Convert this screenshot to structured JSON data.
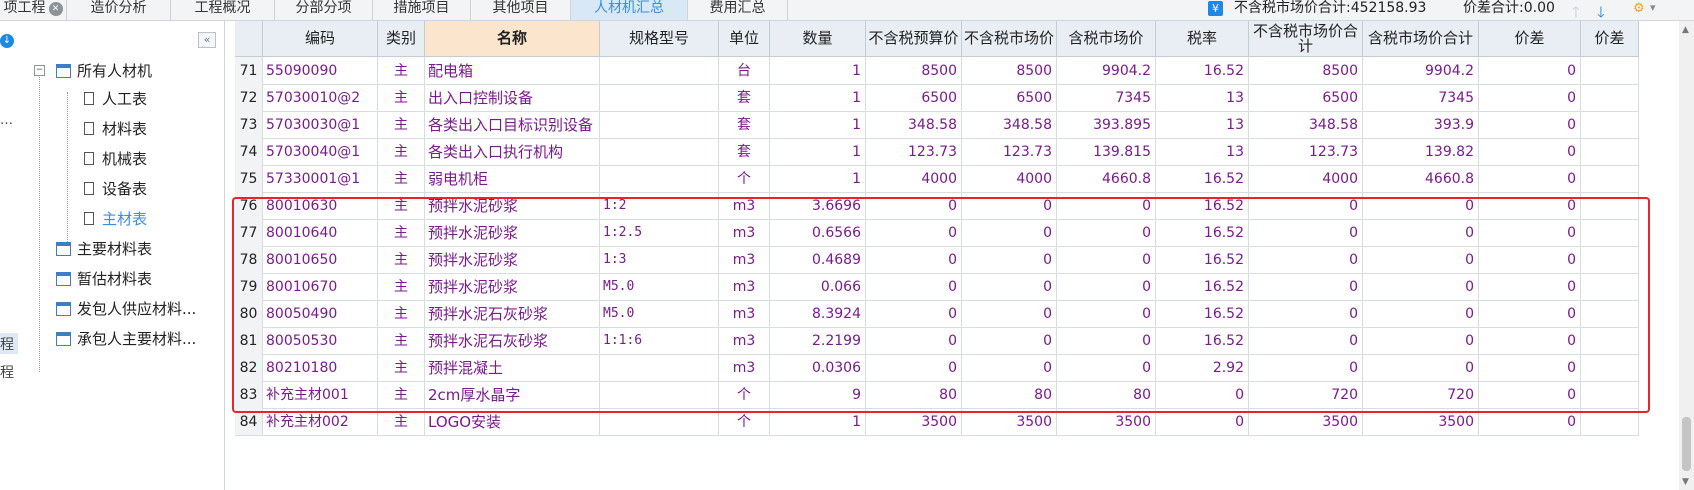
{
  "tabs": [
    {
      "label": "项工程",
      "closable": true
    },
    {
      "label": "造价分析"
    },
    {
      "label": "工程概况"
    },
    {
      "label": "分部分项"
    },
    {
      "label": "措施项目"
    },
    {
      "label": "其他项目"
    },
    {
      "label": "人材机汇总",
      "active": true
    },
    {
      "label": "费用汇总"
    }
  ],
  "summary": {
    "market_total": "不含税市场价合计:452158.93",
    "diff_total": "价差合计:0.00"
  },
  "left_strip": {
    "dots": "…",
    "item_a": "程",
    "item_b": "程"
  },
  "tree": [
    {
      "label": "所有人材机",
      "icon": "table-icon"
    },
    {
      "label": "人工表",
      "icon": "doc-icon"
    },
    {
      "label": "材料表",
      "icon": "doc-icon"
    },
    {
      "label": "机械表",
      "icon": "doc-icon"
    },
    {
      "label": "设备表",
      "icon": "doc-icon"
    },
    {
      "label": "主材表",
      "icon": "doc-icon",
      "selected": true
    },
    {
      "label": "主要材料表",
      "icon": "table-icon"
    },
    {
      "label": "暂估材料表",
      "icon": "table-icon"
    },
    {
      "label": "发包人供应材料...",
      "icon": "table-icon"
    },
    {
      "label": "承包人主要材料...",
      "icon": "table-icon"
    }
  ],
  "columns": [
    "",
    "编码",
    "类别",
    "名称",
    "规格型号",
    "单位",
    "数量",
    "不含税预算价",
    "不含税市场价",
    "含税市场价",
    "税率",
    "不含税市场价合计",
    "含税市场价合计",
    "价差",
    "价差"
  ],
  "rows": [
    [
      "71",
      "55090090",
      "主",
      "配电箱",
      "",
      "台",
      "1",
      "8500",
      "8500",
      "9904.2",
      "16.52",
      "8500",
      "9904.2",
      "0",
      ""
    ],
    [
      "72",
      "57030010@2",
      "主",
      "出入口控制设备",
      "",
      "套",
      "1",
      "6500",
      "6500",
      "7345",
      "13",
      "6500",
      "7345",
      "0",
      ""
    ],
    [
      "73",
      "57030030@1",
      "主",
      "各类出入口目标识别设备",
      "",
      "套",
      "1",
      "348.58",
      "348.58",
      "393.895",
      "13",
      "348.58",
      "393.9",
      "0",
      ""
    ],
    [
      "74",
      "57030040@1",
      "主",
      "各类出入口执行机构",
      "",
      "套",
      "1",
      "123.73",
      "123.73",
      "139.815",
      "13",
      "123.73",
      "139.82",
      "0",
      ""
    ],
    [
      "75",
      "57330001@1",
      "主",
      "弱电机柜",
      "",
      "个",
      "1",
      "4000",
      "4000",
      "4660.8",
      "16.52",
      "4000",
      "4660.8",
      "0",
      ""
    ],
    [
      "76",
      "80010630",
      "主",
      "预拌水泥砂浆",
      "1:2",
      "m3",
      "3.6696",
      "0",
      "0",
      "0",
      "16.52",
      "0",
      "0",
      "0",
      ""
    ],
    [
      "77",
      "80010640",
      "主",
      "预拌水泥砂浆",
      "1:2.5",
      "m3",
      "0.6566",
      "0",
      "0",
      "0",
      "16.52",
      "0",
      "0",
      "0",
      ""
    ],
    [
      "78",
      "80010650",
      "主",
      "预拌水泥砂浆",
      "1:3",
      "m3",
      "0.4689",
      "0",
      "0",
      "0",
      "16.52",
      "0",
      "0",
      "0",
      ""
    ],
    [
      "79",
      "80010670",
      "主",
      "预拌水泥砂浆",
      "M5.0",
      "m3",
      "0.066",
      "0",
      "0",
      "0",
      "16.52",
      "0",
      "0",
      "0",
      ""
    ],
    [
      "80",
      "80050490",
      "主",
      "预拌水泥石灰砂浆",
      "M5.0",
      "m3",
      "8.3924",
      "0",
      "0",
      "0",
      "16.52",
      "0",
      "0",
      "0",
      ""
    ],
    [
      "81",
      "80050530",
      "主",
      "预拌水泥石灰砂浆",
      "1:1:6",
      "m3",
      "2.2199",
      "0",
      "0",
      "0",
      "16.52",
      "0",
      "0",
      "0",
      ""
    ],
    [
      "82",
      "80210180",
      "主",
      "预拌混凝土",
      "",
      "m3",
      "0.0306",
      "0",
      "0",
      "0",
      "2.92",
      "0",
      "0",
      "0",
      ""
    ],
    [
      "83",
      "补充主材001",
      "主",
      "2cm厚水晶字",
      "",
      "个",
      "9",
      "80",
      "80",
      "80",
      "0",
      "720",
      "720",
      "0",
      ""
    ],
    [
      "84",
      "补充主材002",
      "主",
      "LOGO安装",
      "",
      "个",
      "1",
      "3500",
      "3500",
      "3500",
      "0",
      "3500",
      "3500",
      "0",
      ""
    ]
  ],
  "colors": {
    "accent": "#3a8ee6",
    "highlight": "#e8232a",
    "cell_text": "#7a1a8c",
    "name_header": "#fbe6cd"
  }
}
